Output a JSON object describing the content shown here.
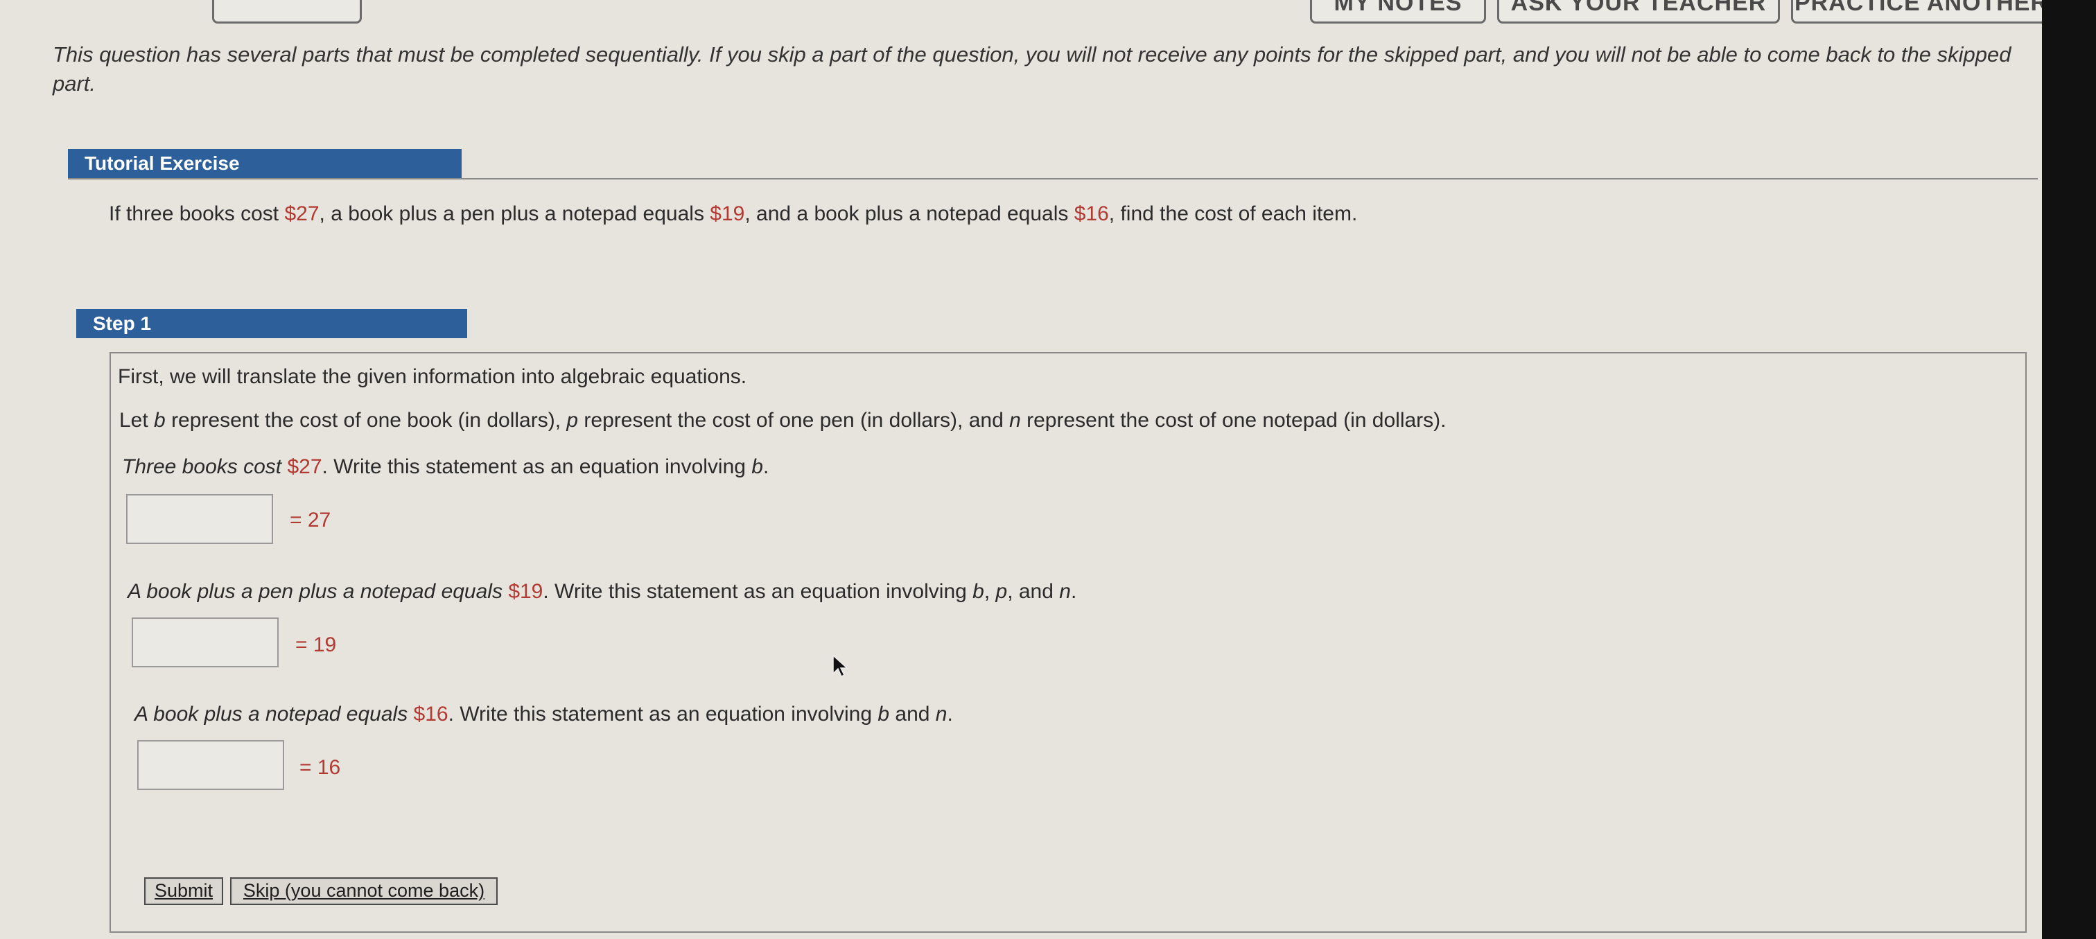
{
  "top_buttons": {
    "my_notes": "MY NOTES",
    "ask_teacher": "ASK YOUR TEACHER",
    "practice_another": "PRACTICE ANOTHER"
  },
  "instructions": "This question has several parts that must be completed sequentially. If you skip a part of the question, you will not receive any points for the skipped part, and you will not be able to come back to the skipped part.",
  "tutorial": {
    "header": "Tutorial Exercise",
    "problem_a": "If three books cost ",
    "problem_v1": "$27",
    "problem_b": ", a book plus a pen plus a notepad equals ",
    "problem_v2": "$19",
    "problem_c": ", and a book plus a notepad equals ",
    "problem_v3": "$16",
    "problem_d": ", find the cost of each item."
  },
  "step1": {
    "header": "Step 1",
    "intro": "First, we will translate the given information into algebraic equations.",
    "define_a": "Let ",
    "define_b_var": "b",
    "define_b": " represent the cost of one book (in dollars), ",
    "define_p_var": "p",
    "define_p": " represent the cost of one pen (in dollars), and ",
    "define_n_var": "n",
    "define_n": " represent the cost of one notepad (in dollars).",
    "q1_a": "Three books cost ",
    "q1_v": "$27",
    "q1_b": ". Write this statement as an equation involving ",
    "q1_var": "b",
    "q1_end": ".",
    "q1_rhs": "= 27",
    "q1_value": "",
    "q2_a": "A book plus a pen plus a notepad equals ",
    "q2_v": "$19",
    "q2_b": ". Write this statement as an equation involving ",
    "q2_vars_b": "b",
    "q2_sep1": ", ",
    "q2_vars_p": "p",
    "q2_sep2": ", and ",
    "q2_vars_n": "n",
    "q2_end": ".",
    "q2_rhs": "= 19",
    "q2_value": "",
    "q3_a": "A book plus a notepad equals ",
    "q3_v": "$16",
    "q3_b": ". Write this statement as an equation involving ",
    "q3_vars_b": "b",
    "q3_sep": " and ",
    "q3_vars_n": "n",
    "q3_end": ".",
    "q3_rhs": "= 16",
    "q3_value": ""
  },
  "buttons": {
    "submit": "Submit",
    "skip": "Skip (you cannot come back)"
  }
}
